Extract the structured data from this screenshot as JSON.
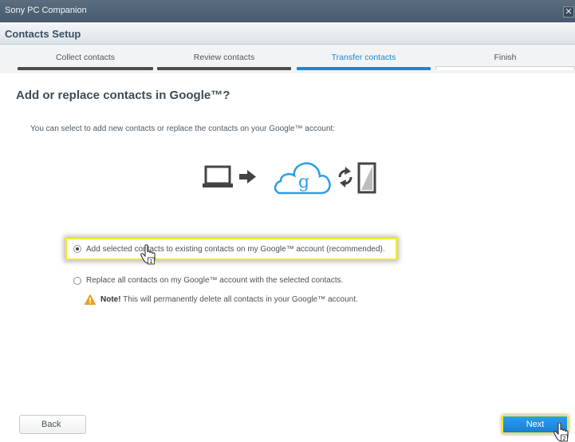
{
  "window": {
    "app_title": "Sony PC Companion",
    "close_glyph": "✕"
  },
  "header": {
    "title": "Contacts Setup"
  },
  "steps": [
    {
      "label": "Collect contacts",
      "state": "done"
    },
    {
      "label": "Review contacts",
      "state": "done"
    },
    {
      "label": "Transfer contacts",
      "state": "active"
    },
    {
      "label": "Finish",
      "state": "pending"
    }
  ],
  "content": {
    "heading": "Add or replace contacts in Google™?",
    "intro": "You can select to add new contacts or replace the contacts on your Google™ account:",
    "illustration": {
      "cloud_letter": "g",
      "icons": [
        "laptop-icon",
        "arrow-right-icon",
        "google-cloud-icon",
        "sync-icon",
        "phone-icon"
      ]
    },
    "options": [
      {
        "label": "Add selected contacts to existing contacts on my Google™ account (recommended).",
        "checked": true
      },
      {
        "label": "Replace all contacts on my Google™ account with the selected contacts.",
        "checked": false
      }
    ],
    "note": {
      "strong": "Note!",
      "text": " This will permanently delete all contacts in your Google™ account."
    },
    "cursor_markers": [
      "1",
      "2"
    ]
  },
  "footer": {
    "back_label": "Back",
    "next_label": "Next"
  },
  "colors": {
    "accent": "#1b86da",
    "highlight": "#f2ea2a",
    "titlebar": "#4f6276"
  }
}
